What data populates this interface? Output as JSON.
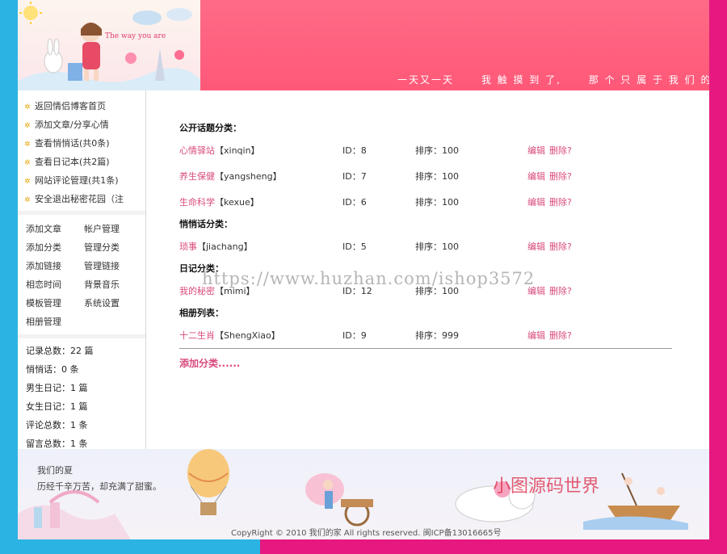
{
  "header": {
    "banner_tagline": "The way you are",
    "slogan": [
      "一天又一天",
      "我 触 摸 到 了,",
      "那 个 只 属 于 我 们 的 < 夏 天 >"
    ]
  },
  "sidebar": {
    "nav": [
      "返回情侣博客首页",
      "添加文章/分享心情",
      "查看悄悄话(共0条)",
      "查看日记本(共2篇)",
      "网站评论管理(共1条)",
      "安全退出秘密花园（注"
    ],
    "admin_links": [
      "添加文章",
      "帐户管理",
      "添加分类",
      "管理分类",
      "添加链接",
      "管理链接",
      "相恋时间",
      "背景音乐",
      "模板管理",
      "系统设置",
      "相册管理"
    ],
    "stats": [
      "记录总数：22 篇",
      "悄悄话：0 条",
      "男生日记：1 篇",
      "女生日记：1 篇",
      "评论总数：1 条",
      "留言总数：1 条"
    ]
  },
  "main": {
    "sections": [
      {
        "title": "公开话题分类：",
        "items": [
          {
            "name": "心情驿站",
            "slug": "【xinqin】",
            "id": "ID：8",
            "order": "排序：100",
            "edit": "编辑",
            "del": "删除?"
          },
          {
            "name": "养生保健",
            "slug": "【yangsheng】",
            "id": "ID：7",
            "order": "排序：100",
            "edit": "编辑",
            "del": "删除?"
          },
          {
            "name": "生命科学",
            "slug": "【kexue】",
            "id": "ID：6",
            "order": "排序：100",
            "edit": "编辑",
            "del": "删除?"
          }
        ]
      },
      {
        "title": "悄悄话分类：",
        "items": [
          {
            "name": "琐事",
            "slug": "【jiachang】",
            "id": "ID：5",
            "order": "排序：100",
            "edit": "编辑",
            "del": "删除?"
          }
        ]
      },
      {
        "title": "日记分类：",
        "items": [
          {
            "name": "我的秘密",
            "slug": "【mimi】",
            "id": "ID：12",
            "order": "排序：100",
            "edit": "编辑",
            "del": "删除?"
          }
        ]
      },
      {
        "title": "相册列表：",
        "items": [
          {
            "name": "十二生肖",
            "slug": "【ShengXiao】",
            "id": "ID：9",
            "order": "排序：999",
            "edit": "编辑",
            "del": "删除?"
          }
        ]
      }
    ],
    "add_category": "添加分类......"
  },
  "watermark": "https://www.huzhan.com/ishop3572",
  "watermark_brand": "小图源码世界",
  "footer": {
    "line1": "我们的夏",
    "line2": "历经千辛万苦，却充满了甜蜜。",
    "copyright": "CopyRight © 2010 我们的家 All rights reserved.  闽ICP备13016665号"
  },
  "colors": {
    "left_edge": "#2bb3e3",
    "right_edge": "#e5197f",
    "header_pink": "#ff5f7e",
    "link_pink": "#d94a7d"
  }
}
